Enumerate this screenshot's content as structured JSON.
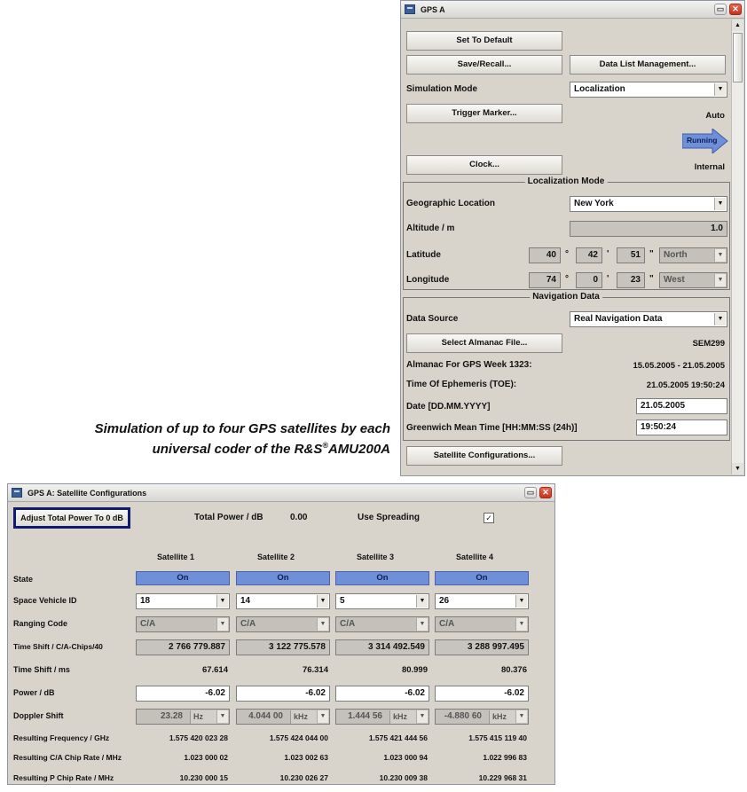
{
  "gps_window": {
    "title": "GPS A",
    "set_default": "Set To Default",
    "save_recall": "Save/Recall...",
    "data_list_management": "Data List Management...",
    "simulation_mode_label": "Simulation Mode",
    "simulation_mode_value": "Localization",
    "trigger_marker": "Trigger Marker...",
    "trigger_status": "Auto",
    "running_label": "Running",
    "clock_button": "Clock...",
    "clock_status": "Internal",
    "localization_section": "Localization Mode",
    "geo_location_label": "Geographic Location",
    "geo_location_value": "New York",
    "altitude_label": "Altitude / m",
    "altitude_value": "1.0",
    "latitude_label": "Latitude",
    "latitude": {
      "deg": "40",
      "min": "42",
      "sec": "51",
      "dir": "North"
    },
    "longitude_label": "Longitude",
    "longitude": {
      "deg": "74",
      "min": "0",
      "sec": "23",
      "dir": "West"
    },
    "degree_symbol": "°",
    "minute_symbol": "'",
    "second_symbol": "\"",
    "navigation_section": "Navigation Data",
    "data_source_label": "Data Source",
    "data_source_value": "Real Navigation Data",
    "select_almanac": "Select Almanac File...",
    "almanac_file": "SEM299",
    "almanac_week_label": "Almanac For GPS Week 1323:",
    "almanac_week_value": "15.05.2005 - 21.05.2005",
    "ephemeris_label": "Time Of Ephemeris (TOE):",
    "ephemeris_value": "21.05.2005 19:50:24",
    "date_label": "Date [DD.MM.YYYY]",
    "date_value": "21.05.2005",
    "gmt_label": "Greenwich Mean Time [HH:MM:SS (24h)]",
    "gmt_value": "19:50:24",
    "satellite_config_button": "Satellite Configurations..."
  },
  "caption": {
    "line1": "Simulation of up to four GPS satellites by each",
    "line2_prefix": "universal coder of the R&S",
    "line2_reg": "®",
    "line2_suffix": "AMU200A"
  },
  "sat_window": {
    "title": "GPS A: Satellite Configurations",
    "adjust_button": "Adjust Total Power To 0 dB",
    "total_power_label": "Total Power / dB",
    "total_power_value": "0.00",
    "use_spreading_label": "Use Spreading",
    "use_spreading_check": "✓",
    "row_labels": {
      "state": "State",
      "svid": "Space Vehicle ID",
      "ranging": "Ranging Code",
      "shift_chips": "Time Shift / C/A-Chips/40",
      "shift_ms": "Time Shift / ms",
      "power": "Power / dB",
      "doppler": "Doppler Shift",
      "freq": "Resulting Frequency / GHz",
      "ca_rate": "Resulting C/A Chip Rate / MHz",
      "p_rate": "Resulting P Chip Rate / MHz"
    },
    "satellites": [
      {
        "name": "Satellite 1",
        "state": "On",
        "svid": "18",
        "ranging": "C/A",
        "shift_chips": "2 766 779.887",
        "shift_ms": "67.614",
        "power": "-6.02",
        "doppler": "23.28",
        "doppler_unit": "Hz",
        "freq": "1.575 420 023 28",
        "ca_rate": "1.023 000 02",
        "p_rate": "10.230 000 15"
      },
      {
        "name": "Satellite 2",
        "state": "On",
        "svid": "14",
        "ranging": "C/A",
        "shift_chips": "3 122 775.578",
        "shift_ms": "76.314",
        "power": "-6.02",
        "doppler": "4.044 00",
        "doppler_unit": "kHz",
        "freq": "1.575 424 044 00",
        "ca_rate": "1.023 002 63",
        "p_rate": "10.230 026 27"
      },
      {
        "name": "Satellite 3",
        "state": "On",
        "svid": "5",
        "ranging": "C/A",
        "shift_chips": "3 314 492.549",
        "shift_ms": "80.999",
        "power": "-6.02",
        "doppler": "1.444 56",
        "doppler_unit": "kHz",
        "freq": "1.575 421 444 56",
        "ca_rate": "1.023 000 94",
        "p_rate": "10.230 009 38"
      },
      {
        "name": "Satellite 4",
        "state": "On",
        "svid": "26",
        "ranging": "C/A",
        "shift_chips": "3 288 997.495",
        "shift_ms": "80.376",
        "power": "-6.02",
        "doppler": "-4.880 60",
        "doppler_unit": "kHz",
        "freq": "1.575 415 119 40",
        "ca_rate": "1.022 996 83",
        "p_rate": "10.229 968 31"
      }
    ]
  },
  "icons": {
    "dropdown": "▼",
    "minimize": "▭",
    "close": "✕",
    "scroll_up": "▲",
    "scroll_down": "▼"
  }
}
